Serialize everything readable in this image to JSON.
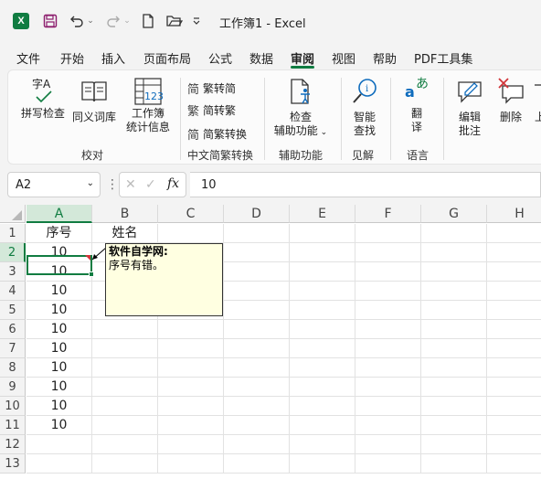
{
  "titlebar": {
    "app_icon": "X",
    "title": "工作簿1  -  Excel"
  },
  "menu": [
    "文件",
    "开始",
    "插入",
    "页面布局",
    "公式",
    "数据",
    "审阅",
    "视图",
    "帮助",
    "PDF工具集"
  ],
  "menu_active": "审阅",
  "ribbon": {
    "proofing": {
      "spell": "拼写检查",
      "thesaurus": "同义词库",
      "stats_line1": "工作簿",
      "stats_line2": "统计信息",
      "group": "校对",
      "spell_icon_text": "字A",
      "stats_icon_text": "123"
    },
    "chinese": {
      "t2s": "繁转简",
      "s2t": "简转繁",
      "convert": "简繁转换",
      "group": "中文简繁转换",
      "t2s_icon": "简",
      "s2t_icon": "繁",
      "convert_icon": "简"
    },
    "accessibility": {
      "line1": "检查",
      "line2": "辅助功能",
      "group": "辅助功能"
    },
    "insights": {
      "line1": "智能",
      "line2": "查找",
      "group": "见解"
    },
    "language": {
      "line1": "翻",
      "line2": "译",
      "group": "语言",
      "icon_a": "a",
      "icon_b": "あ"
    },
    "comments": {
      "edit1": "编辑",
      "edit2": "批注",
      "delete": "删除",
      "more": "上"
    }
  },
  "formula_bar": {
    "name_box": "A2",
    "value": "10",
    "fx": "fx"
  },
  "columns": [
    "A",
    "B",
    "C",
    "D",
    "E",
    "F",
    "G",
    "H"
  ],
  "rows": [
    "1",
    "2",
    "3",
    "4",
    "5",
    "6",
    "7",
    "8",
    "9",
    "10",
    "11",
    "12",
    "13"
  ],
  "cells": {
    "A1": "序号",
    "B1": "姓名",
    "A2": "10",
    "A3": "10",
    "A4": "10",
    "A5": "10",
    "A6": "10",
    "A7": "10",
    "A8": "10",
    "A9": "10",
    "A10": "10",
    "A11": "10"
  },
  "comment": {
    "author": "软件自学网:",
    "text": "序号有错。"
  },
  "colors": {
    "accent": "#107c41",
    "comment_bg": "#ffffe1",
    "indicator": "#d13438"
  }
}
